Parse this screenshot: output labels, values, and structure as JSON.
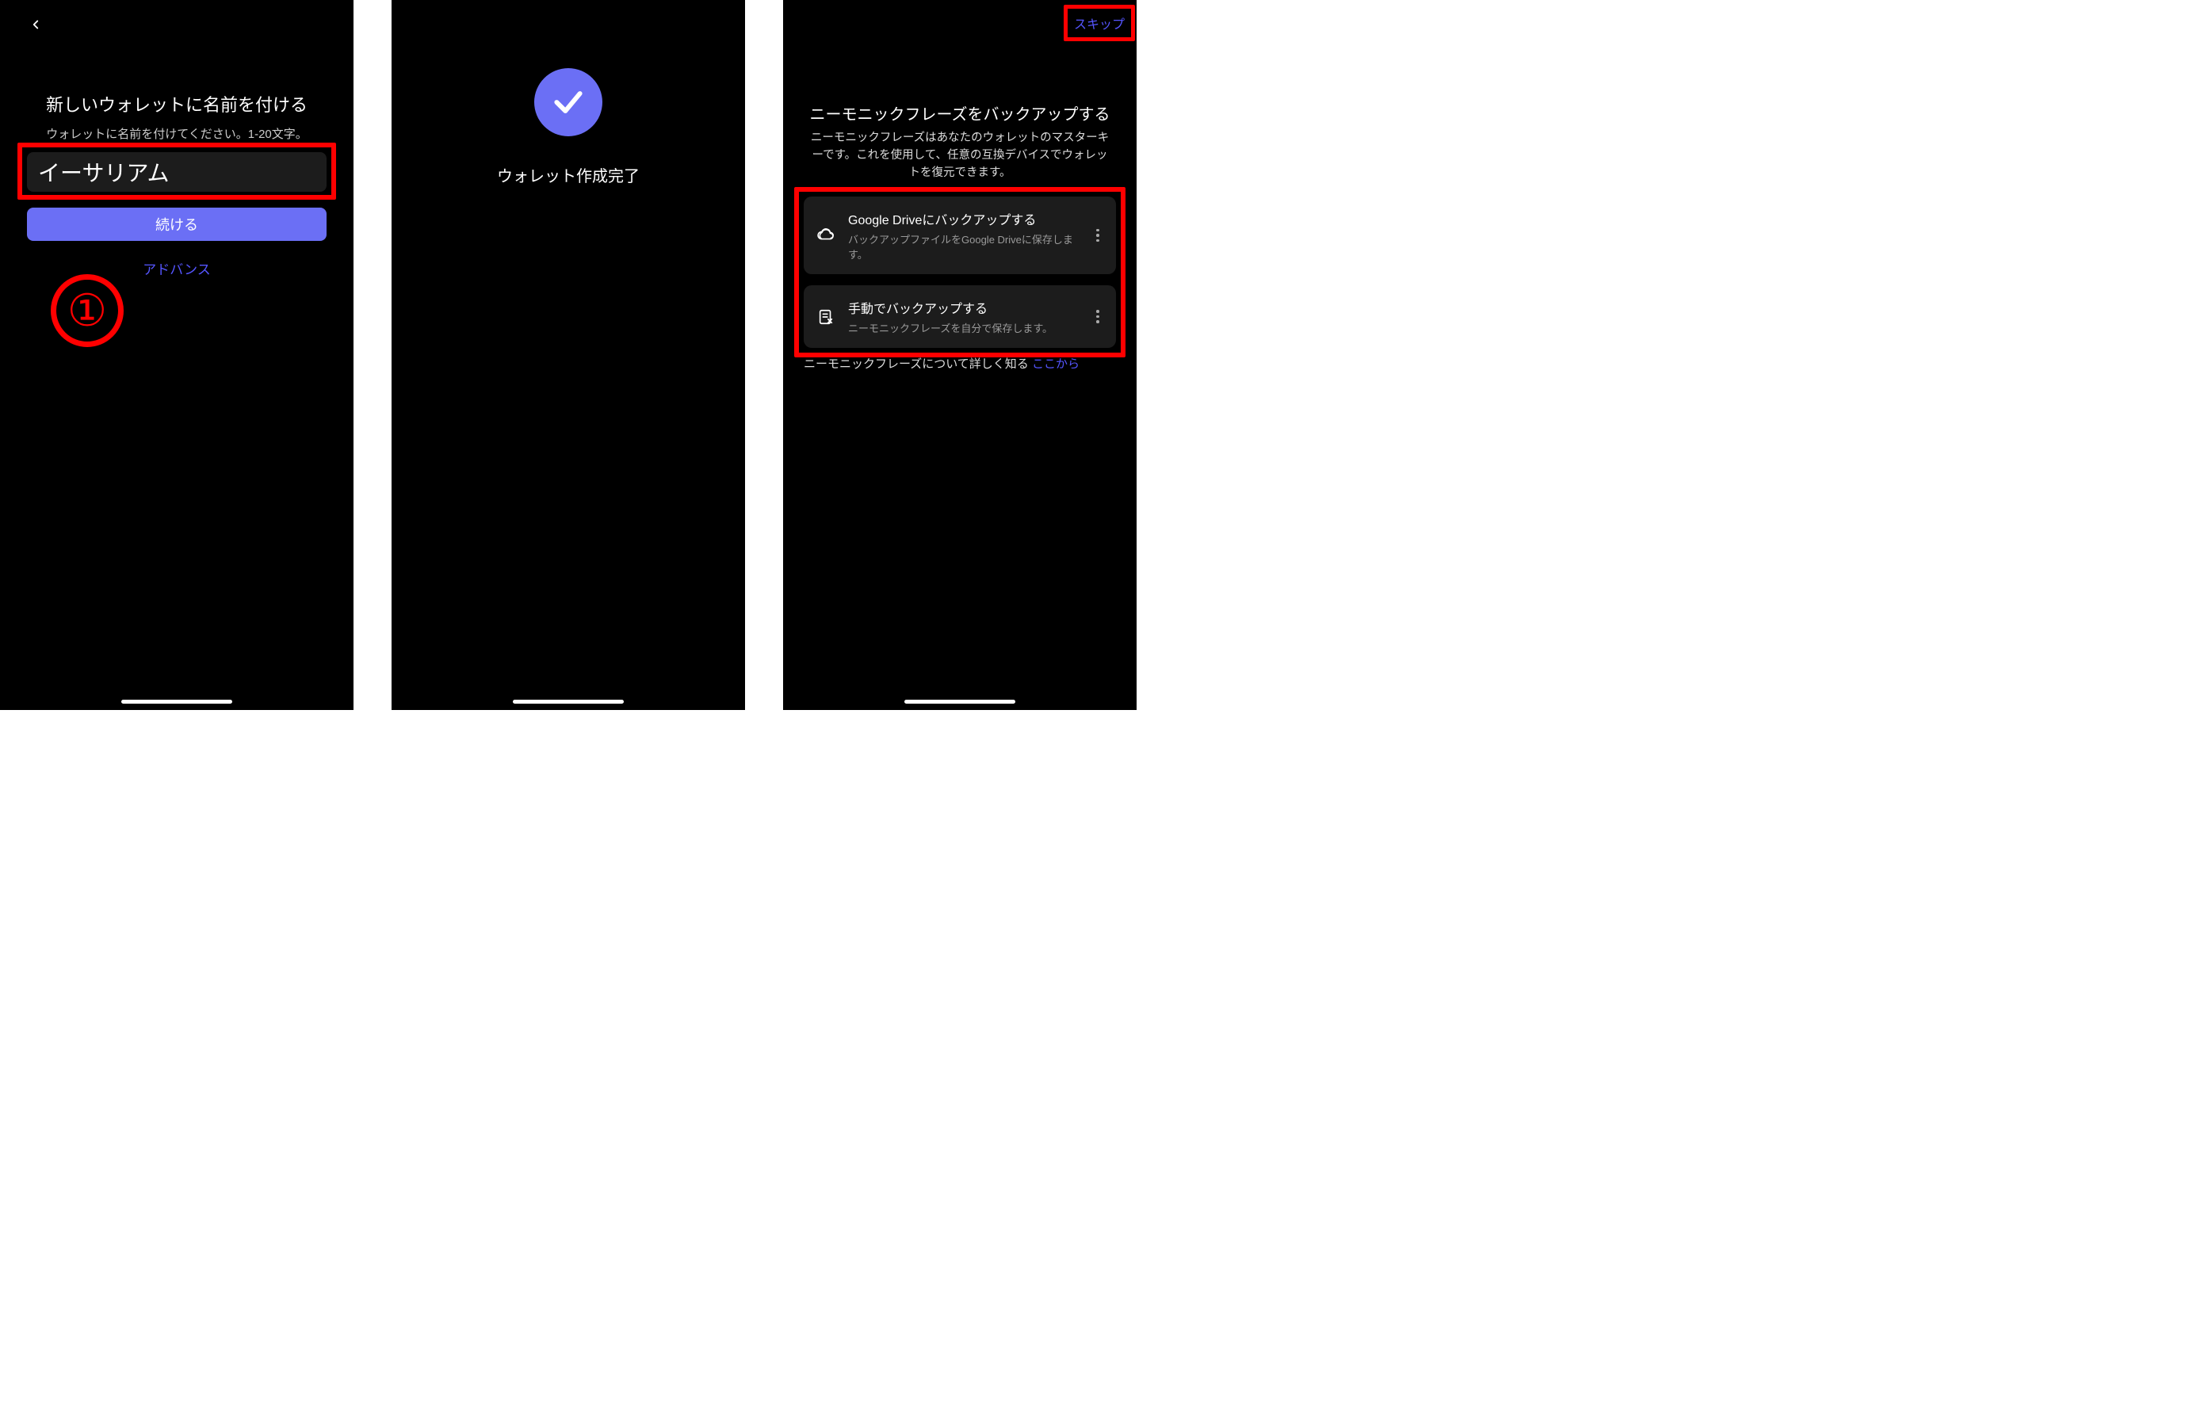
{
  "screen1": {
    "title": "新しいウォレットに名前を付ける",
    "subtitle": "ウォレットに名前を付けてください。1-20文字。",
    "input_value": "イーサリアム",
    "continue_label": "続ける",
    "advance_label": "アドバンス",
    "annotation_number": "①"
  },
  "screen2": {
    "title": "ウォレット作成完了"
  },
  "screen3": {
    "skip_label": "スキップ",
    "title": "ニーモニックフレーズをバックアップする",
    "description": "ニーモニックフレーズはあなたのウォレットのマスターキーです。これを使用して、任意の互換デバイスでウォレットを復元できます。",
    "cards": [
      {
        "title": "Google Driveにバックアップする",
        "subtitle": "バックアップファイルをGoogle Driveに保存します。"
      },
      {
        "title": "手動でバックアップする",
        "subtitle": "ニーモニックフレーズを自分で保存します。"
      }
    ],
    "learn_text": "ニーモニックフレーズについて詳しく知る ",
    "learn_link": "ここから"
  }
}
